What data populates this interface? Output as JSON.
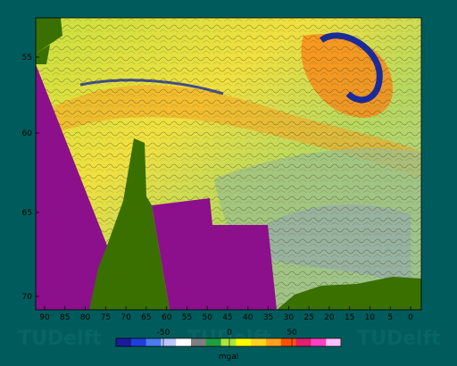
{
  "map": {
    "x_axis": {
      "ticks": [
        "90",
        "85",
        "80",
        "75",
        "70",
        "65",
        "60",
        "55",
        "50",
        "45",
        "40",
        "35",
        "30",
        "25",
        "20",
        "15",
        "10",
        "5",
        "0"
      ]
    },
    "y_axis": {
      "ticks": [
        "55",
        "60",
        "65",
        "70"
      ]
    },
    "colorbar": {
      "ticks": [
        "-50",
        "0",
        "50"
      ],
      "unit": "mgal",
      "colors": [
        "#1a1aa0",
        "#1f3fd8",
        "#4a7cf0",
        "#b8c8ff",
        "#ffffff",
        "#7f7f7f",
        "#1f9f3f",
        "#a8e640",
        "#ffff00",
        "#ffd21f",
        "#ff9f1f",
        "#ff5000",
        "#e02070",
        "#ff40c0",
        "#ffc0ff"
      ]
    },
    "colors": {
      "background": "#005c5c",
      "land": "#8c0f8c",
      "ocean_mask": "#3a7000"
    },
    "watermark": "TUDelft"
  }
}
